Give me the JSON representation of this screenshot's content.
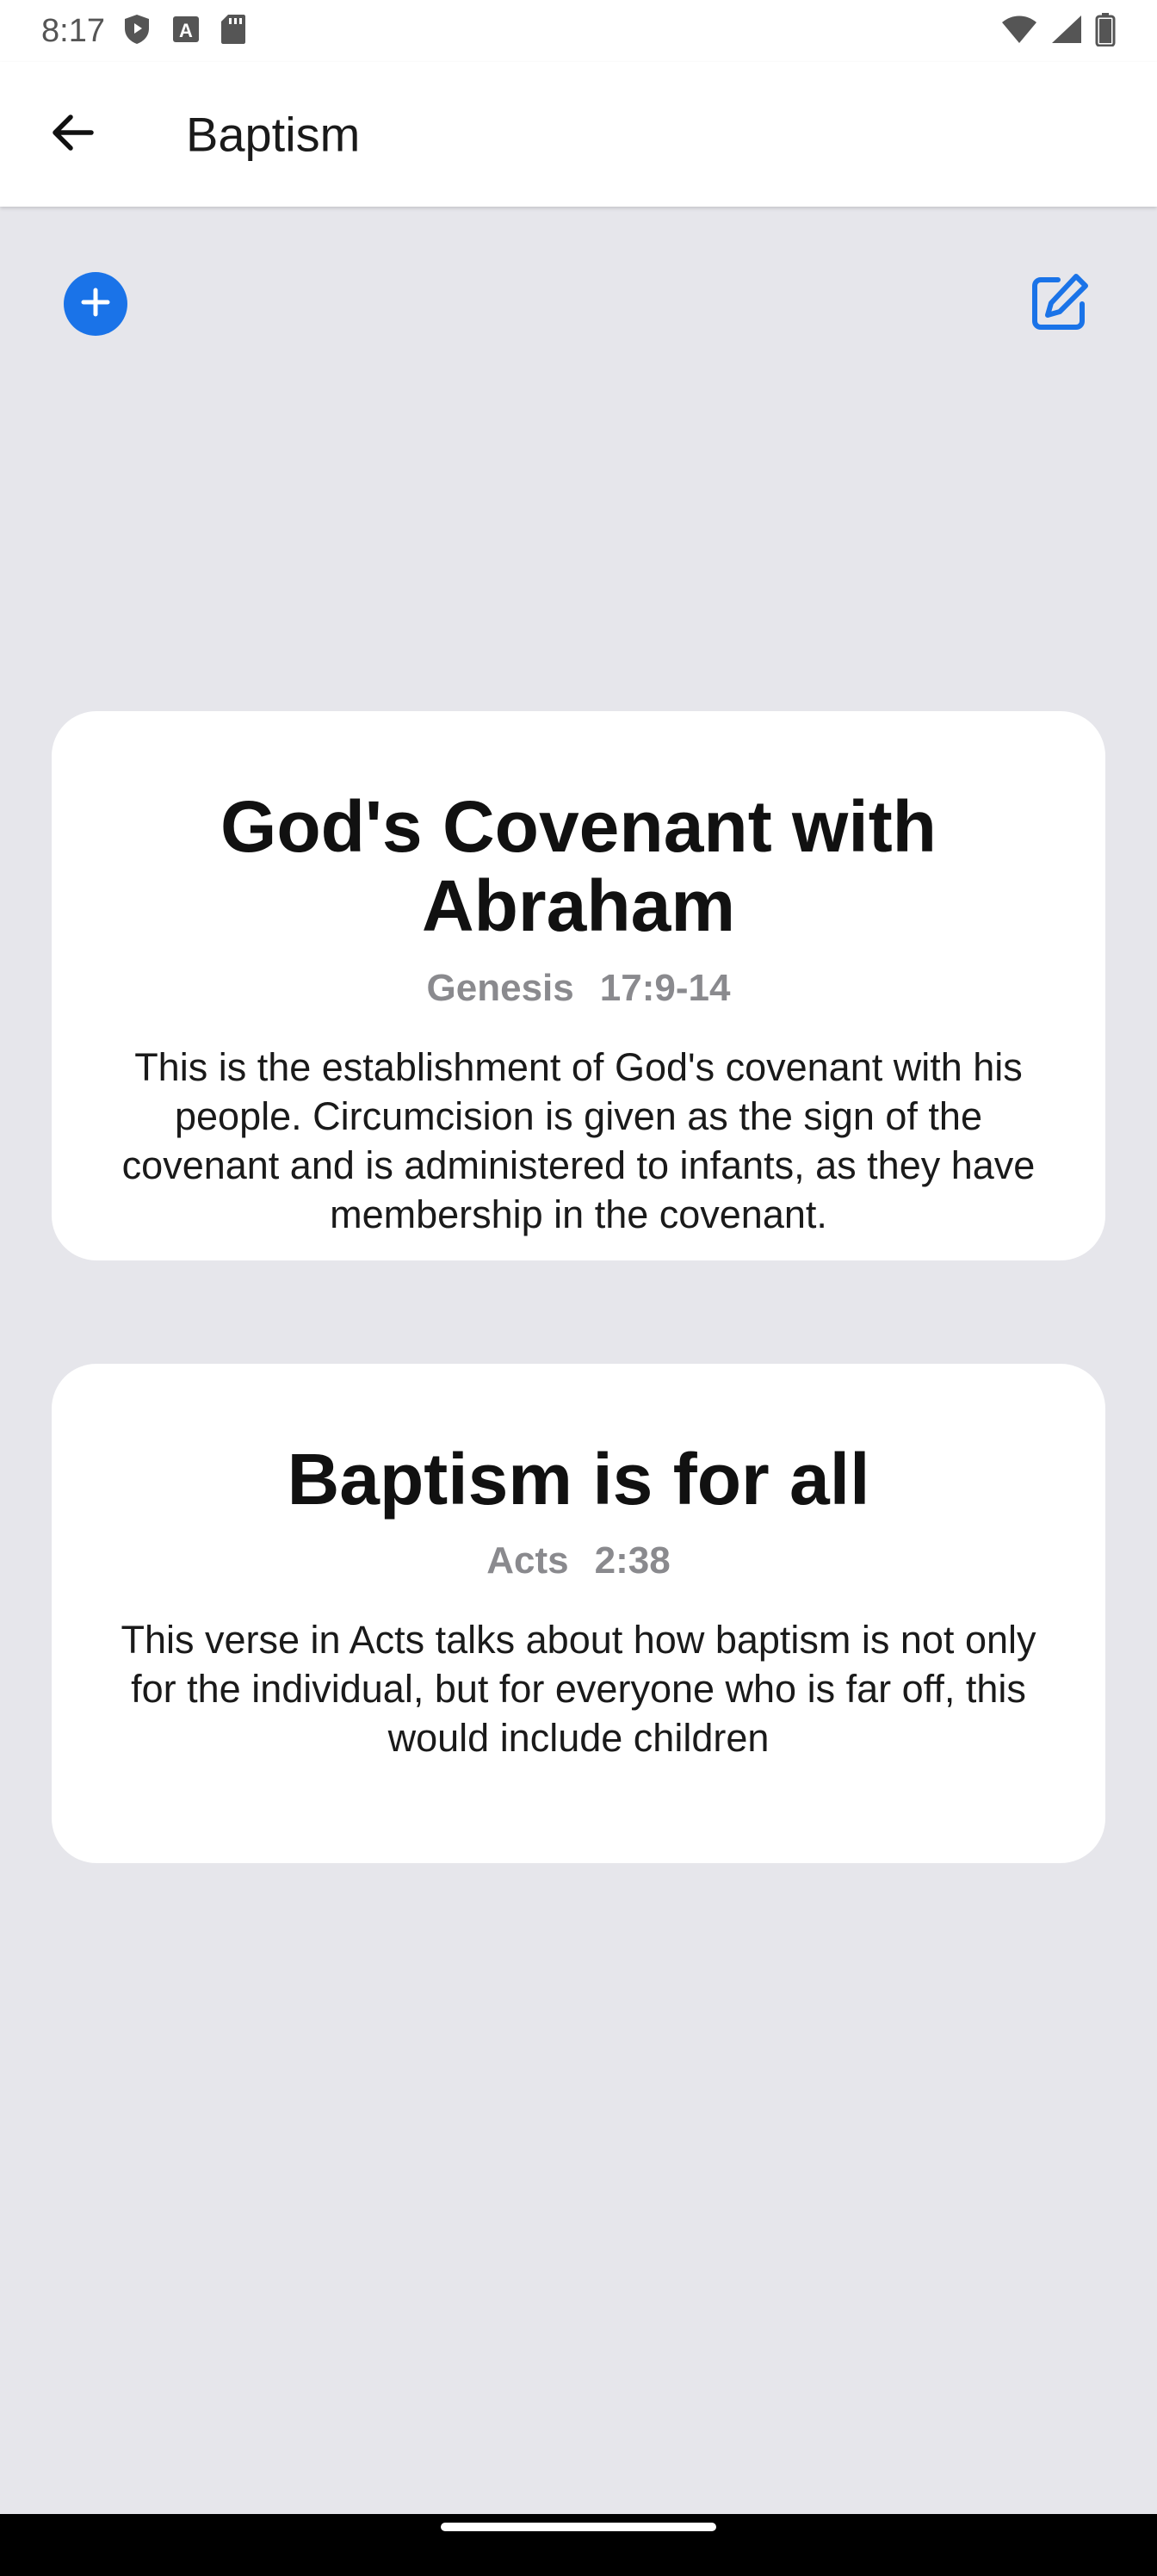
{
  "status_bar": {
    "time": "8:17",
    "left_icons": [
      "shield-icon",
      "text-icon",
      "sd-card-icon"
    ],
    "right_icons": [
      "wifi-icon",
      "signal-icon",
      "battery-icon"
    ]
  },
  "app_bar": {
    "title": "Baptism",
    "back_icon": "arrow-left-icon"
  },
  "toolbar": {
    "add_icon": "plus-circle-icon",
    "edit_icon": "edit-icon"
  },
  "colors": {
    "accent": "#1a73e8",
    "background": "#e6e6eb",
    "card": "#ffffff",
    "reference_text": "#8a8a8e"
  },
  "cards": [
    {
      "title": "God's Covenant with Abraham",
      "book": "Genesis",
      "verse": "17:9-14",
      "description": "This is the establishment of God's covenant with his people. Circumcision is given as the sign of the covenant and is administered to infants, as they have membership in the covenant."
    },
    {
      "title": "Baptism is for all",
      "book": "Acts",
      "verse": "2:38",
      "description": "This verse in Acts talks about how baptism is not only for the individual, but for everyone who is far off, this would include children"
    }
  ]
}
